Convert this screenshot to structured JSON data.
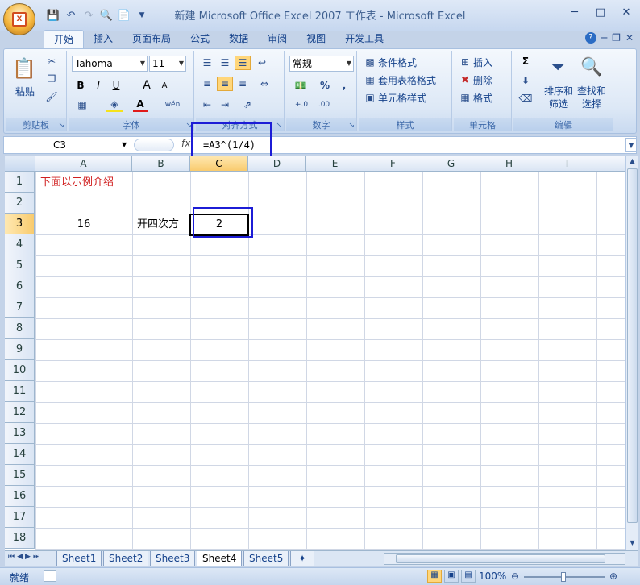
{
  "window": {
    "title": "新建 Microsoft Office Excel 2007 工作表 - Microsoft Excel",
    "office_button_label": "X"
  },
  "tabs": [
    "开始",
    "插入",
    "页面布局",
    "公式",
    "数据",
    "审阅",
    "视图",
    "开发工具"
  ],
  "ribbon": {
    "clipboard": {
      "label": "剪贴板",
      "paste": "粘贴"
    },
    "font": {
      "label": "字体",
      "font_name": "Tahoma",
      "font_size": "11",
      "bold": "B",
      "italic": "I",
      "underline": "U",
      "grow": "A",
      "shrink": "A",
      "font_color_glyph": "A",
      "phonetic": "wén"
    },
    "alignment": {
      "label": "对齐方式"
    },
    "number": {
      "label": "数字",
      "format": "常规",
      "percent": "%",
      "comma": ",",
      "inc_decimal": "+.0",
      "dec_decimal": ".00"
    },
    "styles": {
      "label": "样式",
      "conditional": "条件格式",
      "table": "套用表格格式",
      "cell_styles": "单元格样式"
    },
    "cells": {
      "label": "单元格",
      "insert": "插入",
      "delete": "删除",
      "format": "格式"
    },
    "editing": {
      "label": "编辑",
      "sort_filter": "排序和筛选",
      "find_select": "查找和选择",
      "sigma": "Σ"
    }
  },
  "formula_bar": {
    "name_box": "C3",
    "fx": "fx",
    "formula": "=A3^(1/4)"
  },
  "columns": [
    "A",
    "B",
    "C",
    "D",
    "E",
    "F",
    "G",
    "H",
    "I"
  ],
  "rows": [
    "1",
    "2",
    "3",
    "4",
    "5",
    "6",
    "7",
    "8",
    "9",
    "10",
    "11",
    "12",
    "13",
    "14",
    "15",
    "16",
    "17",
    "18"
  ],
  "cells": {
    "A1": "下面以示例介绍",
    "A3": "16",
    "B3": "开四次方",
    "C3": "2"
  },
  "sheets": [
    "Sheet1",
    "Sheet2",
    "Sheet3",
    "Sheet4",
    "Sheet5"
  ],
  "active_sheet": "Sheet4",
  "status": {
    "mode": "就绪",
    "zoom": "100%"
  },
  "colors": {
    "highlight_box": "#1c1cd6",
    "a1_text": "#d01f1f",
    "ribbon_bg": "#dde8f6"
  }
}
